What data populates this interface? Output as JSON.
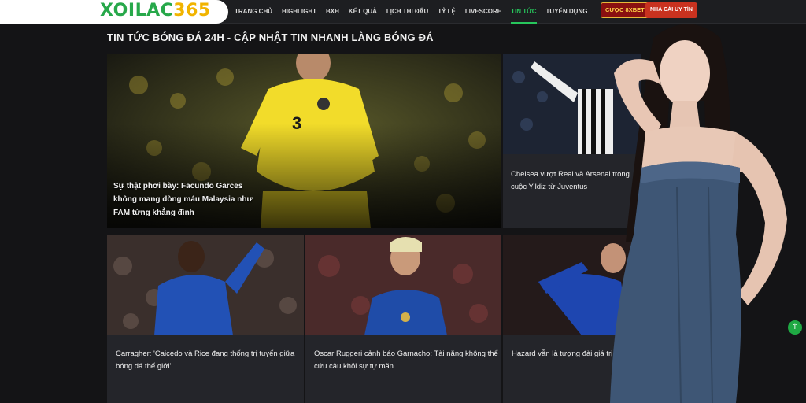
{
  "header": {
    "logo": {
      "part1": "XOILAC",
      "part2": "365"
    },
    "nav": [
      {
        "label": "TRANG CHỦ",
        "active": false
      },
      {
        "label": "HIGHLIGHT",
        "active": false
      },
      {
        "label": "BXH",
        "active": false
      },
      {
        "label": "KẾT QUẢ",
        "active": false
      },
      {
        "label": "LỊCH THI ĐẤU",
        "active": false
      },
      {
        "label": "TỶ LỆ",
        "active": false
      },
      {
        "label": "LIVESCORE",
        "active": false
      },
      {
        "label": "TIN TỨC",
        "active": true
      },
      {
        "label": "TUYỂN DỤNG",
        "active": false
      }
    ],
    "cta_primary": "CƯỢC 8XBET",
    "cta_secondary": "NHÀ CÁI UY TÍN"
  },
  "main": {
    "title": "TIN TỨC BÓNG ĐÁ 24H - CẬP NHẬT TIN NHANH LÀNG BÓNG ĐÁ",
    "featured": {
      "headline": "Sự thật phơi bày: Facundo Garces không mang dòng máu Malaysia như FAM từng khẳng định"
    },
    "side": {
      "headline": "Chelsea vượt Real và Arsenal trong cuộc Yildiz từ Juventus"
    },
    "grid": [
      {
        "headline": "Carragher: 'Caicedo và Rice đang thống trị tuyến giữa bóng đá thế giới'"
      },
      {
        "headline": "Oscar Ruggeri cảnh báo Garnacho: Tài năng không thể cứu cậu khỏi sự tự mãn"
      },
      {
        "headline": "Hazard vẫn là tượng đài giá trị cứ thách thức kỷ lục"
      }
    ]
  },
  "colors": {
    "background": "#141416",
    "accent_green": "#27c65c",
    "logo_green": "#27a84a",
    "logo_yellow": "#f1b400",
    "cta_red": "#c9321f"
  },
  "icons": {
    "scroll_top": "arrow-up-icon"
  }
}
